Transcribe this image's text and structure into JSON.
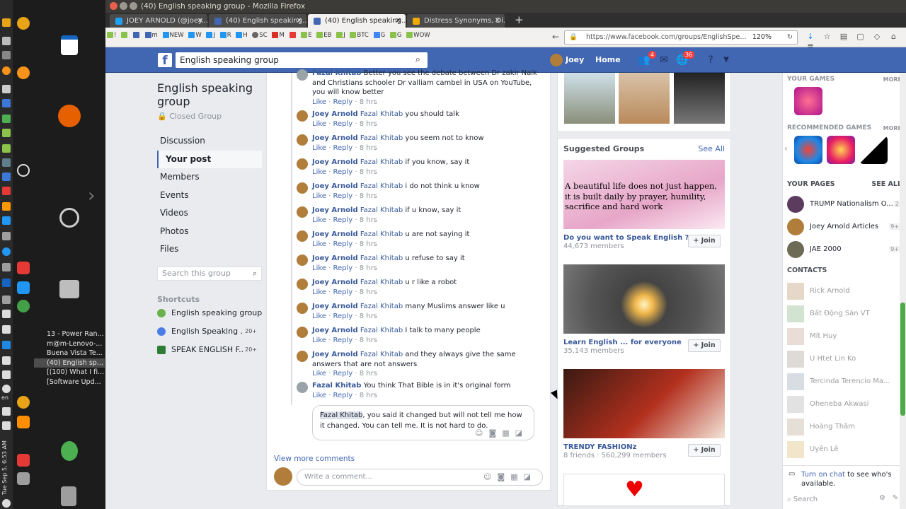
{
  "window": {
    "title": "(40) English speaking group - Mozilla Firefox"
  },
  "tabs": [
    {
      "label": "JOEY ARNOLD (@joey...",
      "active": false
    },
    {
      "label": "(40) English speaking...",
      "active": false
    },
    {
      "label": "(40) English speaking...",
      "active": true
    },
    {
      "label": "Distress Synonyms, Di...",
      "active": false
    }
  ],
  "bookmarks": [
    "!",
    "m",
    "NEW",
    "W",
    "J",
    "R",
    "H",
    "SC",
    "M",
    "E",
    "EB",
    "J",
    "BTC",
    "G",
    "G",
    "WOW"
  ],
  "url": {
    "text": "https://www.facebook.com/groups/EnglishSpe...",
    "zoom": "120%"
  },
  "fb": {
    "search_value": "English speaking group",
    "user_name": "Joey",
    "home_label": "Home",
    "friend_badge": "4",
    "notif_badge": "36"
  },
  "group": {
    "title": "English speaking group",
    "privacy": "Closed Group",
    "nav": [
      "Discussion",
      "Your post",
      "Members",
      "Events",
      "Videos",
      "Photos",
      "Files"
    ],
    "search_placeholder": "Search this group",
    "shortcuts_label": "Shortcuts",
    "shortcuts": [
      {
        "name": "English speaking group",
        "count": ""
      },
      {
        "name": "English Speaking ...",
        "count": "20+"
      },
      {
        "name": "SPEAK ENGLISH F...",
        "count": "20+"
      }
    ]
  },
  "comments": [
    {
      "author": "Fazal Khitab",
      "tag": "",
      "text": "Better you see the debate between Dr zakir Naik and Christians schooler Dr valliam cambel in USA on YouTube, you will know better",
      "like": "Like",
      "reply": "Reply",
      "time": "8 hrs"
    },
    {
      "author": "Joey Arnold",
      "tag": "Fazal Khitab",
      "text": "you should talk",
      "like": "Like",
      "reply": "Reply",
      "time": "8 hrs"
    },
    {
      "author": "Joey Arnold",
      "tag": "Fazal Khitab",
      "text": "you seem not to know",
      "like": "Like",
      "reply": "Reply",
      "time": "8 hrs"
    },
    {
      "author": "Joey Arnold",
      "tag": "Fazal Khitab",
      "text": "if you know, say it",
      "like": "Like",
      "reply": "Reply",
      "time": "8 hrs"
    },
    {
      "author": "Joey Arnold",
      "tag": "Fazal Khitab",
      "text": "i do not think u know",
      "like": "Like",
      "reply": "Reply",
      "time": "8 hrs"
    },
    {
      "author": "Joey Arnold",
      "tag": "Fazal Khitab",
      "text": "if u know, say it",
      "like": "Like",
      "reply": "Reply",
      "time": "8 hrs"
    },
    {
      "author": "Joey Arnold",
      "tag": "Fazal Khitab",
      "text": "u are not saying it",
      "like": "Like",
      "reply": "Reply",
      "time": "8 hrs"
    },
    {
      "author": "Joey Arnold",
      "tag": "Fazal Khitab",
      "text": "u refuse to say it",
      "like": "Like",
      "reply": "Reply",
      "time": "8 hrs"
    },
    {
      "author": "Joey Arnold",
      "tag": "Fazal Khitab",
      "text": "u r like a robot",
      "like": "Like",
      "reply": "Reply",
      "time": "8 hrs"
    },
    {
      "author": "Joey Arnold",
      "tag": "Fazal Khitab",
      "text": "many Muslims answer like u",
      "like": "Like",
      "reply": "Reply",
      "time": "8 hrs"
    },
    {
      "author": "Joey Arnold",
      "tag": "Fazal Khitab",
      "text": "I talk to many people",
      "like": "Like",
      "reply": "Reply",
      "time": "8 hrs"
    },
    {
      "author": "Joey Arnold",
      "tag": "Fazal Khitab",
      "text": "and they always give the same answers that are not answers",
      "like": "Like",
      "reply": "Reply",
      "time": "8 hrs"
    },
    {
      "author": "Fazal Khitab",
      "tag": "",
      "text": "You think That Bible is in it's original form",
      "like": "Like",
      "reply": "Reply",
      "time": "8 hrs"
    }
  ],
  "reply_draft": {
    "mention": "Fazal Khitab",
    "text": ", you said it changed but will not tell me how it changed. You can tell me. It is not hard to do."
  },
  "view_more": "View more comments",
  "write_placeholder": "Write a comment...",
  "suggested": {
    "heading": "Suggested Groups",
    "see_all": "See All",
    "join_label": "+ Join",
    "groups": [
      {
        "name": "Do you want to Speak English ?",
        "members": "44,673 members",
        "quote": "A beautiful life does not just happen, it is built daily by prayer, humility, sacrifice and hard work"
      },
      {
        "name": "Learn English ... for everyone",
        "members": "35,143 members"
      },
      {
        "name": "TRENDY FASHIONz",
        "members": "8 friends · 560,299 members"
      }
    ]
  },
  "right": {
    "your_games": "YOUR GAMES",
    "more": "MORE",
    "recommended": "RECOMMENDED GAMES",
    "your_pages": "YOUR PAGES",
    "see_all": "SEE ALL",
    "pages": [
      {
        "name": "TRUMP Nationalism O...",
        "count": "2"
      },
      {
        "name": "Joey Arnold Articles",
        "count": "9+"
      },
      {
        "name": "JAE 2000",
        "count": "9+"
      }
    ],
    "contacts_label": "CONTACTS",
    "contacts": [
      "Rick Arnold",
      "Bất Động Sản VT",
      "Mít Huy",
      "U Htet Lin Ko",
      "Tercinda Terencio Ma...",
      "Oheneba Akwasi",
      "Hoàng Thâm",
      "Uyên Lê"
    ],
    "chat_link": "Turn on chat",
    "chat_text": " to see who's available.",
    "chat_search": "Search"
  },
  "dock": {
    "windows": [
      "13 - Power Ran...",
      "m@m-Lenovo-...",
      "Buena Vista Te...",
      "(40) English sp...",
      "[(100) What I fi...",
      "[Software Upd..."
    ],
    "lang": "en",
    "clock": "Tue Sep 5, 6:53 AM"
  },
  "colors": {
    "fb_blue": "#4267b2",
    "link": "#385898"
  }
}
